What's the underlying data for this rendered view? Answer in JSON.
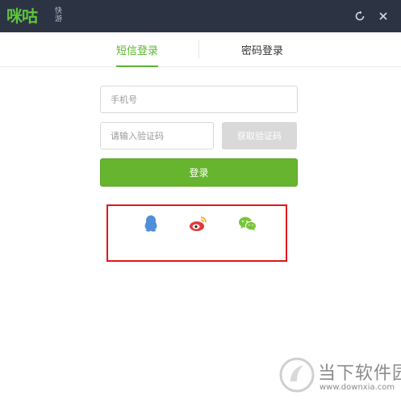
{
  "titlebar": {
    "logo_text": "咪咕",
    "logo_sub": "快游"
  },
  "tabs": [
    {
      "label": "短信登录",
      "active": true
    },
    {
      "label": "密码登录",
      "active": false
    }
  ],
  "form": {
    "phone_placeholder": "手机号",
    "code_placeholder": "请输入验证码",
    "get_code_label": "获取验证码",
    "login_label": "登录"
  },
  "social": [
    "qq-icon",
    "weibo-icon",
    "wechat-icon"
  ],
  "watermark": {
    "title": "当下软件园",
    "url": "www.downxia.com"
  },
  "colors": {
    "accent": "#67b52e",
    "titlebar": "#2c3444",
    "highlight": "#e3141c",
    "qq": "#4d8fd8",
    "weibo": "#e4393c",
    "wechat": "#79c43c"
  }
}
